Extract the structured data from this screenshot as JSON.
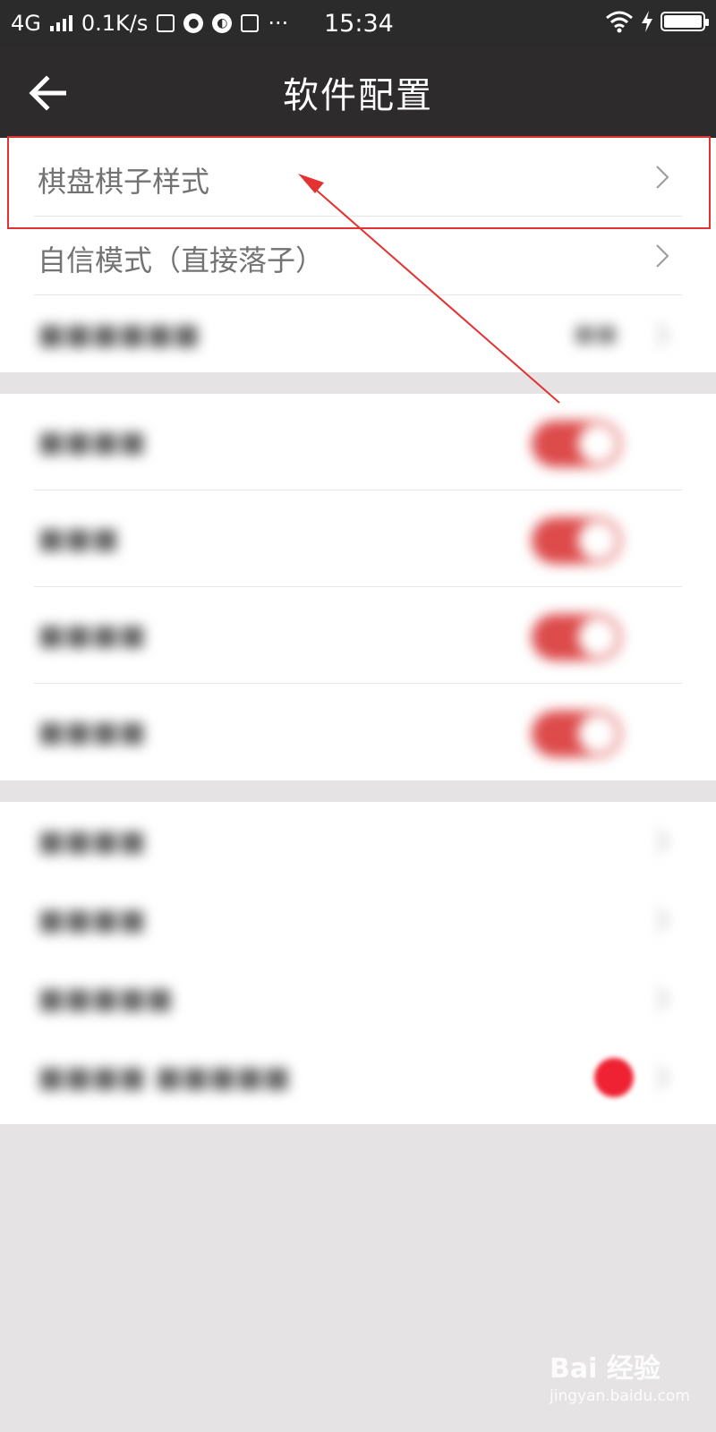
{
  "status_bar": {
    "network": "4G",
    "speed": "0.1K/s",
    "time": "15:34"
  },
  "header": {
    "title": "软件配置"
  },
  "settings": {
    "board_style": "棋盘棋子样式",
    "confident_mode": "自信模式（直接落子）"
  },
  "colors": {
    "header_bg": "#2d2b2b",
    "toggle_on": "#dd4b4b",
    "annotation": "#e23232",
    "badge": "#ee2233"
  },
  "watermark": {
    "brand": "Bai 经验",
    "url": "jingyan.baidu.com"
  }
}
